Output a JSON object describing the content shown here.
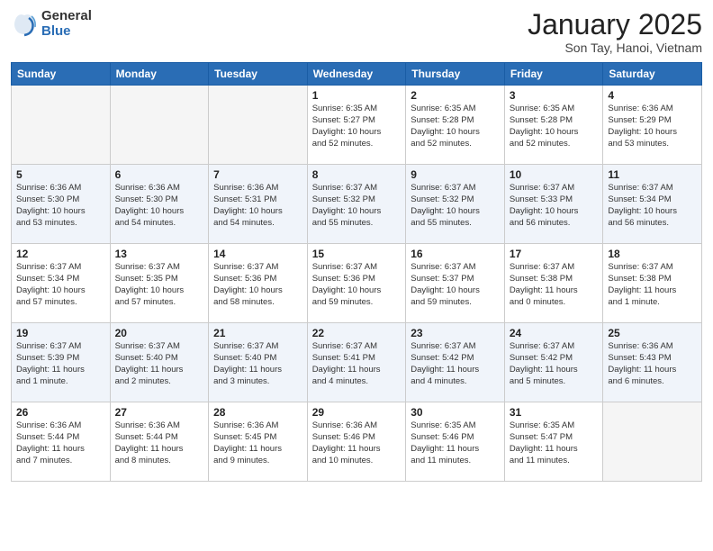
{
  "logo": {
    "general": "General",
    "blue": "Blue"
  },
  "title": "January 2025",
  "location": "Son Tay, Hanoi, Vietnam",
  "days_of_week": [
    "Sunday",
    "Monday",
    "Tuesday",
    "Wednesday",
    "Thursday",
    "Friday",
    "Saturday"
  ],
  "weeks": [
    [
      {
        "num": "",
        "info": ""
      },
      {
        "num": "",
        "info": ""
      },
      {
        "num": "",
        "info": ""
      },
      {
        "num": "1",
        "info": "Sunrise: 6:35 AM\nSunset: 5:27 PM\nDaylight: 10 hours\nand 52 minutes."
      },
      {
        "num": "2",
        "info": "Sunrise: 6:35 AM\nSunset: 5:28 PM\nDaylight: 10 hours\nand 52 minutes."
      },
      {
        "num": "3",
        "info": "Sunrise: 6:35 AM\nSunset: 5:28 PM\nDaylight: 10 hours\nand 52 minutes."
      },
      {
        "num": "4",
        "info": "Sunrise: 6:36 AM\nSunset: 5:29 PM\nDaylight: 10 hours\nand 53 minutes."
      }
    ],
    [
      {
        "num": "5",
        "info": "Sunrise: 6:36 AM\nSunset: 5:30 PM\nDaylight: 10 hours\nand 53 minutes."
      },
      {
        "num": "6",
        "info": "Sunrise: 6:36 AM\nSunset: 5:30 PM\nDaylight: 10 hours\nand 54 minutes."
      },
      {
        "num": "7",
        "info": "Sunrise: 6:36 AM\nSunset: 5:31 PM\nDaylight: 10 hours\nand 54 minutes."
      },
      {
        "num": "8",
        "info": "Sunrise: 6:37 AM\nSunset: 5:32 PM\nDaylight: 10 hours\nand 55 minutes."
      },
      {
        "num": "9",
        "info": "Sunrise: 6:37 AM\nSunset: 5:32 PM\nDaylight: 10 hours\nand 55 minutes."
      },
      {
        "num": "10",
        "info": "Sunrise: 6:37 AM\nSunset: 5:33 PM\nDaylight: 10 hours\nand 56 minutes."
      },
      {
        "num": "11",
        "info": "Sunrise: 6:37 AM\nSunset: 5:34 PM\nDaylight: 10 hours\nand 56 minutes."
      }
    ],
    [
      {
        "num": "12",
        "info": "Sunrise: 6:37 AM\nSunset: 5:34 PM\nDaylight: 10 hours\nand 57 minutes."
      },
      {
        "num": "13",
        "info": "Sunrise: 6:37 AM\nSunset: 5:35 PM\nDaylight: 10 hours\nand 57 minutes."
      },
      {
        "num": "14",
        "info": "Sunrise: 6:37 AM\nSunset: 5:36 PM\nDaylight: 10 hours\nand 58 minutes."
      },
      {
        "num": "15",
        "info": "Sunrise: 6:37 AM\nSunset: 5:36 PM\nDaylight: 10 hours\nand 59 minutes."
      },
      {
        "num": "16",
        "info": "Sunrise: 6:37 AM\nSunset: 5:37 PM\nDaylight: 10 hours\nand 59 minutes."
      },
      {
        "num": "17",
        "info": "Sunrise: 6:37 AM\nSunset: 5:38 PM\nDaylight: 11 hours\nand 0 minutes."
      },
      {
        "num": "18",
        "info": "Sunrise: 6:37 AM\nSunset: 5:38 PM\nDaylight: 11 hours\nand 1 minute."
      }
    ],
    [
      {
        "num": "19",
        "info": "Sunrise: 6:37 AM\nSunset: 5:39 PM\nDaylight: 11 hours\nand 1 minute."
      },
      {
        "num": "20",
        "info": "Sunrise: 6:37 AM\nSunset: 5:40 PM\nDaylight: 11 hours\nand 2 minutes."
      },
      {
        "num": "21",
        "info": "Sunrise: 6:37 AM\nSunset: 5:40 PM\nDaylight: 11 hours\nand 3 minutes."
      },
      {
        "num": "22",
        "info": "Sunrise: 6:37 AM\nSunset: 5:41 PM\nDaylight: 11 hours\nand 4 minutes."
      },
      {
        "num": "23",
        "info": "Sunrise: 6:37 AM\nSunset: 5:42 PM\nDaylight: 11 hours\nand 4 minutes."
      },
      {
        "num": "24",
        "info": "Sunrise: 6:37 AM\nSunset: 5:42 PM\nDaylight: 11 hours\nand 5 minutes."
      },
      {
        "num": "25",
        "info": "Sunrise: 6:36 AM\nSunset: 5:43 PM\nDaylight: 11 hours\nand 6 minutes."
      }
    ],
    [
      {
        "num": "26",
        "info": "Sunrise: 6:36 AM\nSunset: 5:44 PM\nDaylight: 11 hours\nand 7 minutes."
      },
      {
        "num": "27",
        "info": "Sunrise: 6:36 AM\nSunset: 5:44 PM\nDaylight: 11 hours\nand 8 minutes."
      },
      {
        "num": "28",
        "info": "Sunrise: 6:36 AM\nSunset: 5:45 PM\nDaylight: 11 hours\nand 9 minutes."
      },
      {
        "num": "29",
        "info": "Sunrise: 6:36 AM\nSunset: 5:46 PM\nDaylight: 11 hours\nand 10 minutes."
      },
      {
        "num": "30",
        "info": "Sunrise: 6:35 AM\nSunset: 5:46 PM\nDaylight: 11 hours\nand 11 minutes."
      },
      {
        "num": "31",
        "info": "Sunrise: 6:35 AM\nSunset: 5:47 PM\nDaylight: 11 hours\nand 11 minutes."
      },
      {
        "num": "",
        "info": ""
      }
    ]
  ]
}
